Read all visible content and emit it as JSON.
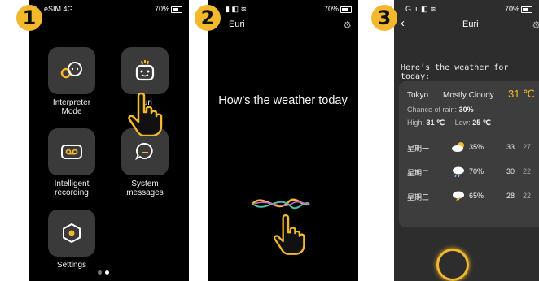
{
  "steps": [
    "1",
    "2",
    "3"
  ],
  "phone1": {
    "status_left": "eSIM 4G",
    "status_right": "70%",
    "apps": [
      {
        "label": "Interpreter Mode"
      },
      {
        "label": "Euri"
      },
      {
        "label": "Intelligent recording"
      },
      {
        "label": "System messages"
      },
      {
        "label": "Settings"
      }
    ]
  },
  "phone2": {
    "status_right": "70%",
    "title": "Euri",
    "question": "How’s the weather today"
  },
  "phone3": {
    "status_right": "70%",
    "title": "Euri",
    "greeting": "Here’s the weather for today:",
    "city": "Tokyo",
    "condition": "Mostly Cloudy",
    "temp": "31 ℃",
    "rain_label": "Chance of rain:",
    "rain_value": "30%",
    "high_label": "High:",
    "high_value": "31 ℃",
    "low_label": "Low:",
    "low_value": "25 ℃",
    "forecast": [
      {
        "day": "星期一",
        "icon": "partly-cloudy-icon",
        "pct": "35%",
        "hi": "33",
        "lo": "27"
      },
      {
        "day": "星期二",
        "icon": "rain-cloud-icon",
        "pct": "70%",
        "hi": "30",
        "lo": "22"
      },
      {
        "day": "星期三",
        "icon": "storm-cloud-icon",
        "pct": "65%",
        "hi": "28",
        "lo": "22"
      }
    ]
  },
  "colors": {
    "accent": "#f3b82b",
    "phone_bg": "#000000",
    "card_bg": "#3d3d3d"
  }
}
